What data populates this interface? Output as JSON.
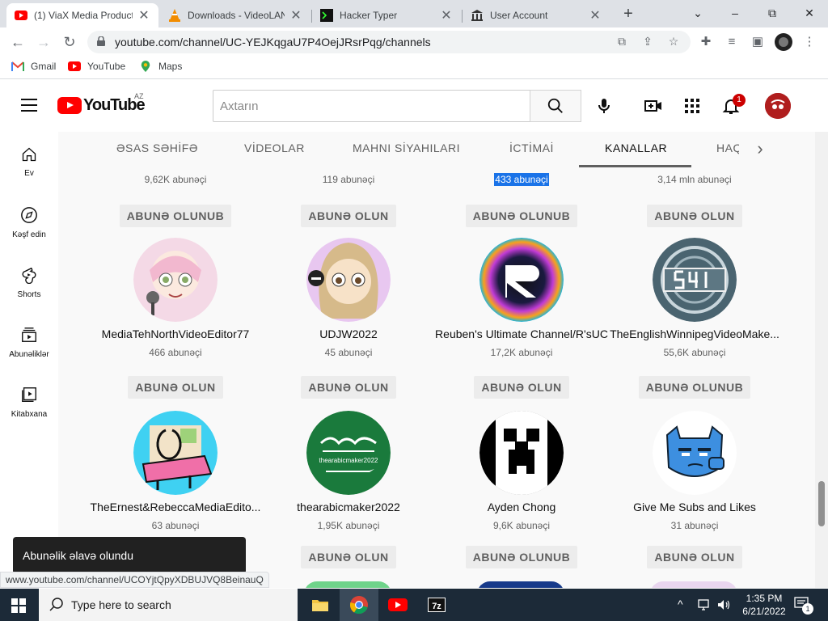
{
  "browser": {
    "tabs": [
      {
        "title": "(1) ViaX Media Product",
        "active": true
      },
      {
        "title": "Downloads - VideoLAN",
        "active": false
      },
      {
        "title": "Hacker Typer",
        "active": false
      },
      {
        "title": "User Account",
        "active": false
      }
    ],
    "new_tab": "+",
    "window": {
      "minimize": "⌄",
      "min": "–",
      "max": "⧉",
      "close": "✕"
    },
    "url": "youtube.com/channel/UC-YEJKqgaU7P4OejJRsrPqg/channels",
    "bookmarks": [
      "Gmail",
      "YouTube",
      "Maps"
    ],
    "status_url": "www.youtube.com/channel/UCOYjtQpyXDBUJVQ8BeinauQ"
  },
  "youtube": {
    "country_code": "AZ",
    "logo_text": "YouTube",
    "search_placeholder": "Axtarın",
    "notification_count": "1",
    "sidebar": [
      {
        "label": "Ev",
        "icon": "home-icon"
      },
      {
        "label": "Kəşf edin",
        "icon": "explore-icon"
      },
      {
        "label": "Shorts",
        "icon": "shorts-icon"
      },
      {
        "label": "Abunəliklər",
        "icon": "subscriptions-icon"
      },
      {
        "label": "Kitabxana",
        "icon": "library-icon"
      }
    ],
    "channel_tabs": [
      "ƏSAS SƏHİFƏ",
      "VİDEOLAR",
      "MAHNI SİYAHILARI",
      "İCTİMAİ",
      "KANALLAR",
      "HAQ"
    ],
    "active_tab": "KANALLAR",
    "top_row": [
      {
        "subs": "9,62K abunəçi",
        "button": "ABUNƏ OLUNUB"
      },
      {
        "subs": "119 abunəçi",
        "button": "ABUNƏ OLUN"
      },
      {
        "subs": "433 abunəçi",
        "button": "ABUNƏ OLUNUB",
        "selected": true
      },
      {
        "subs": "3,14 mln abunəçi",
        "button": "ABUNƏ OLUN"
      }
    ],
    "row2": [
      {
        "name": "MediaTehNorthVideoEditor77",
        "subs": "466 abunəçi",
        "button": "ABUNƏ OLUN"
      },
      {
        "name": "UDJW2022",
        "subs": "45 abunəçi",
        "button": "ABUNƏ OLUN"
      },
      {
        "name": "Reuben's Ultimate Channel/R'sUC",
        "subs": "17,2K abunəçi",
        "button": "ABUNƏ OLUN"
      },
      {
        "name": "TheEnglishWinnipegVideoMake...",
        "subs": "55,6K abunəçi",
        "button": "ABUNƏ OLUNUB"
      }
    ],
    "row3": [
      {
        "name": "TheErnest&RebeccaMediaEdito...",
        "subs": "63 abunəçi",
        "button": ""
      },
      {
        "name": "thearabicmaker2022",
        "subs": "1,95K abunəçi",
        "button": "ABUNƏ OLUN"
      },
      {
        "name": "Ayden Chong",
        "subs": "9,6K abunəçi",
        "button": "ABUNƏ OLUNUB"
      },
      {
        "name": "Give Me Subs and Likes",
        "subs": "31 abunəçi",
        "button": "ABUNƏ OLUN"
      }
    ],
    "toast": "Abunəlik əlavə olundu"
  },
  "taskbar": {
    "search_placeholder": "Type here to search",
    "time": "1:35 PM",
    "date": "6/21/2022",
    "notifications": "1"
  }
}
